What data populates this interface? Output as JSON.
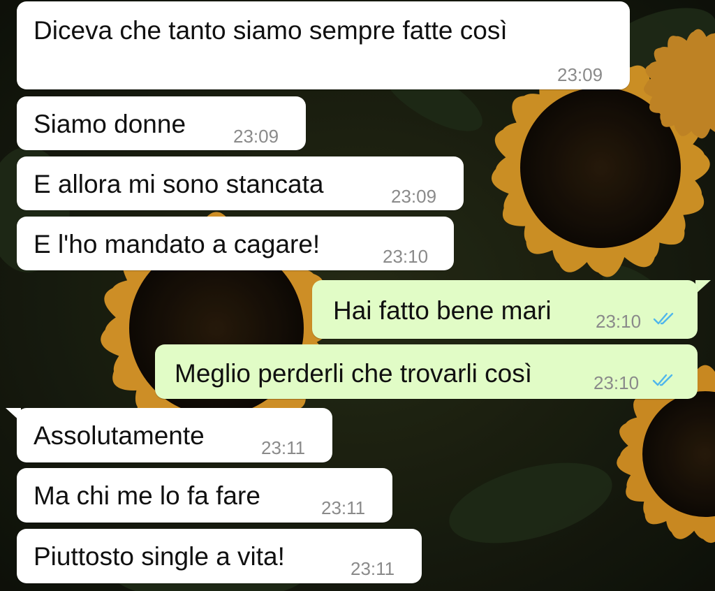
{
  "colors": {
    "incoming_bubble": "#ffffff",
    "outgoing_bubble": "#e1fcc6",
    "timestamp": "#8a8a8a",
    "read_ticks": "#4fb6ec"
  },
  "wallpaper": {
    "subject": "sunflowers"
  },
  "messages": [
    {
      "direction": "incoming",
      "text": "Diceva che tanto siamo sempre fatte così",
      "time": "23:09"
    },
    {
      "direction": "incoming",
      "text": "Siamo donne",
      "time": "23:09"
    },
    {
      "direction": "incoming",
      "text": "E allora mi sono stancata",
      "time": "23:09"
    },
    {
      "direction": "incoming",
      "text": "E l'ho mandato a cagare!",
      "time": "23:10"
    },
    {
      "direction": "outgoing",
      "text": "Hai fatto bene mari",
      "time": "23:10",
      "status_icon": "double-check-icon"
    },
    {
      "direction": "outgoing",
      "text": "Meglio perderli che trovarli così",
      "time": "23:10",
      "status_icon": "double-check-icon"
    },
    {
      "direction": "incoming",
      "text": "Assolutamente",
      "time": "23:11"
    },
    {
      "direction": "incoming",
      "text": "Ma chi me lo fa fare",
      "time": "23:11"
    },
    {
      "direction": "incoming",
      "text": "Piuttosto single a vita!",
      "time": "23:11"
    }
  ]
}
